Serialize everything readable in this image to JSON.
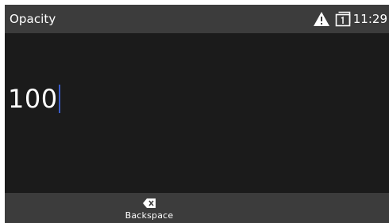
{
  "header": {
    "title": "Opacity",
    "time": "11:29",
    "icons": [
      "warning-icon",
      "sim-icon"
    ]
  },
  "input": {
    "value": "100"
  },
  "softkeys": {
    "backspace_label": "Backspace",
    "backspace_icon": "backspace-icon"
  },
  "colors": {
    "statusbar_bg": "#3c3c3c",
    "content_bg": "#1b1b1b",
    "cursor": "#3a5cc8",
    "text": "#ffffff"
  }
}
